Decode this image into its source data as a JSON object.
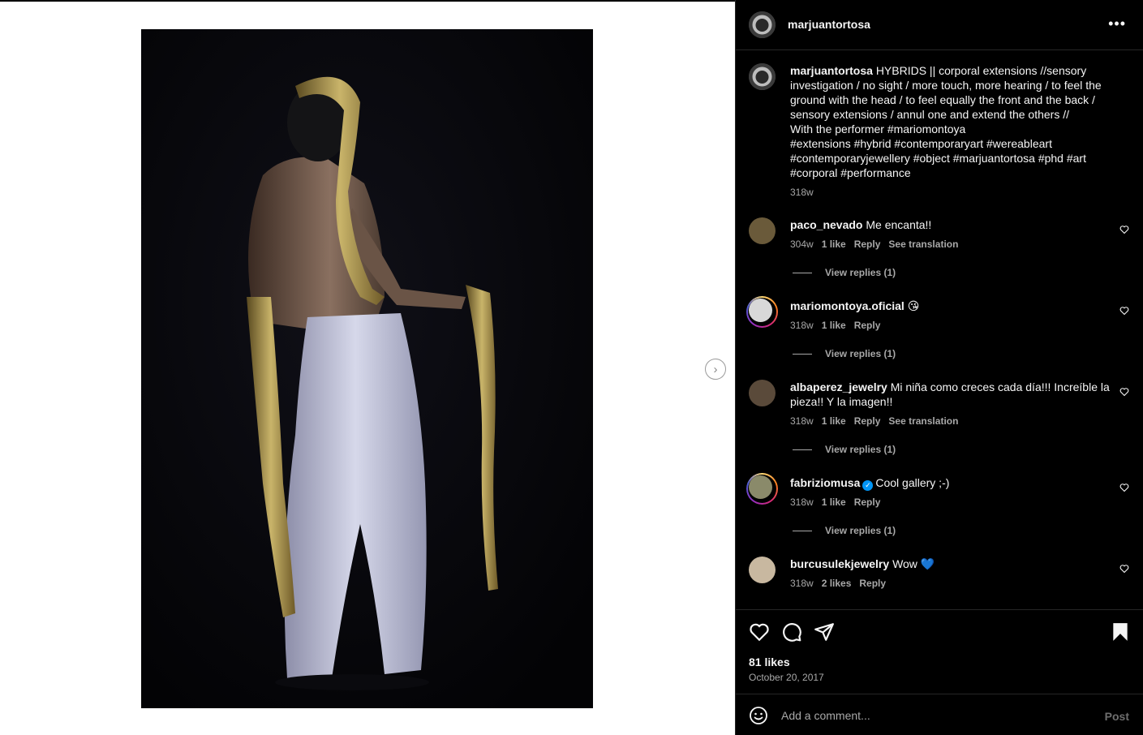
{
  "post": {
    "author": "marjuantortosa",
    "more_icon": "more-horizontal-icon",
    "caption_text": "HYBRIDS || corporal extensions //sensory investigation / no sight / more touch, more hearing / to feel the ground with the head / to feel equally the front and the back / sensory extensions / annul one and extend the others //\nWith the performer #mariomontoya\n#extensions #hybrid #contemporaryart #wereableart\n#contemporaryjewellery #object #marjuantortosa #phd #art\n#corporal #performance",
    "caption_age": "318w",
    "likes": "81 likes",
    "date": "October 20, 2017"
  },
  "comments": [
    {
      "user": "paco_nevado",
      "text": "Me encanta!!",
      "age": "304w",
      "likes": "1 like",
      "reply": "Reply",
      "translate": "See translation",
      "view_replies": "View replies (1)"
    },
    {
      "user": "mariomontoya.oficial",
      "text": "😘",
      "age": "318w",
      "likes": "1 like",
      "reply": "Reply",
      "view_replies": "View replies (1)"
    },
    {
      "user": "albaperez_jewelry",
      "text": "Mi niña como creces cada día!!! Increíble la pieza!! Y la imagen!!",
      "age": "318w",
      "likes": "1 like",
      "reply": "Reply",
      "translate": "See translation",
      "view_replies": "View replies (1)"
    },
    {
      "user": "fabriziomusa",
      "text": "Cool gallery ;-)",
      "age": "318w",
      "likes": "1 like",
      "reply": "Reply",
      "view_replies": "View replies (1)"
    },
    {
      "user": "burcusulekjewelry",
      "text": "Wow 💙",
      "age": "318w",
      "likes": "2 likes",
      "reply": "Reply"
    }
  ],
  "comment_box": {
    "placeholder": "Add a comment...",
    "post_label": "Post"
  },
  "icons": {
    "next": "chevron-right-icon",
    "like": "heart-icon",
    "comment": "comment-bubble-icon",
    "share": "paper-plane-icon",
    "save": "bookmark-icon",
    "emoji": "smiley-icon"
  },
  "colors": {
    "panel_bg": "#000000",
    "text": "#f5f5f5",
    "muted": "#a8a8a8",
    "verified": "#0095f6"
  }
}
